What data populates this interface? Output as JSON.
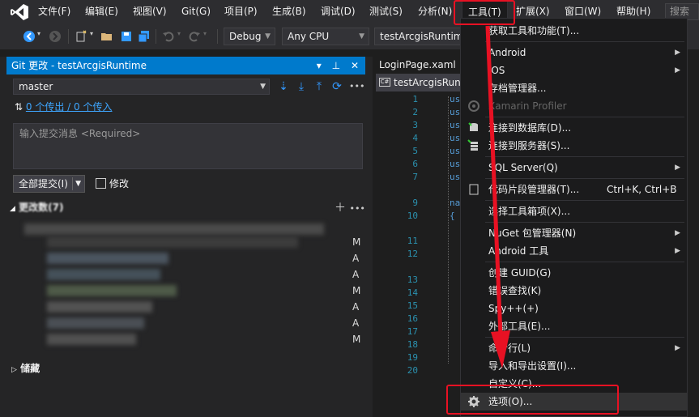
{
  "menubar": {
    "items": [
      "文件(F)",
      "编辑(E)",
      "视图(V)",
      "Git(G)",
      "项目(P)",
      "生成(B)",
      "调试(D)",
      "测试(S)",
      "分析(N)",
      "工具(T)",
      "扩展(X)",
      "窗口(W)",
      "帮助(H)"
    ],
    "search_placeholder": "搜索"
  },
  "toolbar": {
    "config": "Debug",
    "platform": "Any CPU",
    "startup_project": "testArcgisRuntime"
  },
  "git_panel": {
    "title": "Git 更改 - testArcgisRuntime",
    "branch": "master",
    "outgoing": "0 个传出",
    "sync_sep": " / ",
    "incoming": "0 个传入",
    "commit_placeholder": "输入提交消息 <Required>",
    "commit_all_label": "全部提交(I)",
    "amend_label": "修改",
    "changes_header": "更改数(7)",
    "statuses": [
      "M",
      "A",
      "A",
      "M",
      "A",
      "A",
      "M"
    ],
    "stash_header": "储藏"
  },
  "editor": {
    "tab_active": "LoginPage.xaml",
    "tab_file": "testArcgisRun",
    "line_numbers": [
      "1",
      "2",
      "3",
      "4",
      "5",
      "6",
      "7",
      "8",
      "9",
      "10",
      "11",
      "12",
      "13",
      "14",
      "15",
      "16",
      "17",
      "18",
      "19",
      "20"
    ],
    "code_fragments": [
      "us",
      "us",
      "us",
      "us",
      "us",
      "us",
      "us",
      "na",
      "{"
    ]
  },
  "tools_menu": {
    "items": [
      {
        "label": "获取工具和功能(T)...",
        "shortcut": "",
        "submenu": false,
        "disabled": false
      },
      {
        "label": "Android",
        "shortcut": "",
        "submenu": true,
        "disabled": false
      },
      {
        "label": "iOS",
        "shortcut": "",
        "submenu": true,
        "disabled": false
      },
      {
        "label": "存档管理器...",
        "shortcut": "",
        "submenu": false,
        "disabled": false
      },
      {
        "label": "Xamarin Profiler",
        "shortcut": "",
        "submenu": false,
        "disabled": true
      },
      {
        "label": "连接到数据库(D)...",
        "shortcut": "",
        "submenu": false,
        "disabled": false
      },
      {
        "label": "连接到服务器(S)...",
        "shortcut": "",
        "submenu": false,
        "disabled": false
      },
      {
        "label": "SQL Server(Q)",
        "shortcut": "",
        "submenu": true,
        "disabled": false
      },
      {
        "label": "代码片段管理器(T)...",
        "shortcut": "Ctrl+K, Ctrl+B",
        "submenu": false,
        "disabled": false
      },
      {
        "label": "选择工具箱项(X)...",
        "shortcut": "",
        "submenu": false,
        "disabled": false
      },
      {
        "label": "NuGet 包管理器(N)",
        "shortcut": "",
        "submenu": true,
        "disabled": false
      },
      {
        "label": "Android 工具",
        "shortcut": "",
        "submenu": true,
        "disabled": false
      },
      {
        "label": "创建 GUID(G)",
        "shortcut": "",
        "submenu": false,
        "disabled": false
      },
      {
        "label": "错误查找(K)",
        "shortcut": "",
        "submenu": false,
        "disabled": false
      },
      {
        "label": "Spy++(+)",
        "shortcut": "",
        "submenu": false,
        "disabled": false
      },
      {
        "label": "外部工具(E)...",
        "shortcut": "",
        "submenu": false,
        "disabled": false
      },
      {
        "label": "命令行(L)",
        "shortcut": "",
        "submenu": true,
        "disabled": false
      },
      {
        "label": "导入和导出设置(I)...",
        "shortcut": "",
        "submenu": false,
        "disabled": false
      },
      {
        "label": "自定义(C)...",
        "shortcut": "",
        "submenu": false,
        "disabled": false
      },
      {
        "label": "选项(O)...",
        "shortcut": "",
        "submenu": false,
        "disabled": false
      }
    ]
  },
  "colors": {
    "accent": "#007acc",
    "annotation": "#e81123",
    "menu_bg": "#1b1b1c",
    "chrome_bg": "#2d2d30"
  }
}
